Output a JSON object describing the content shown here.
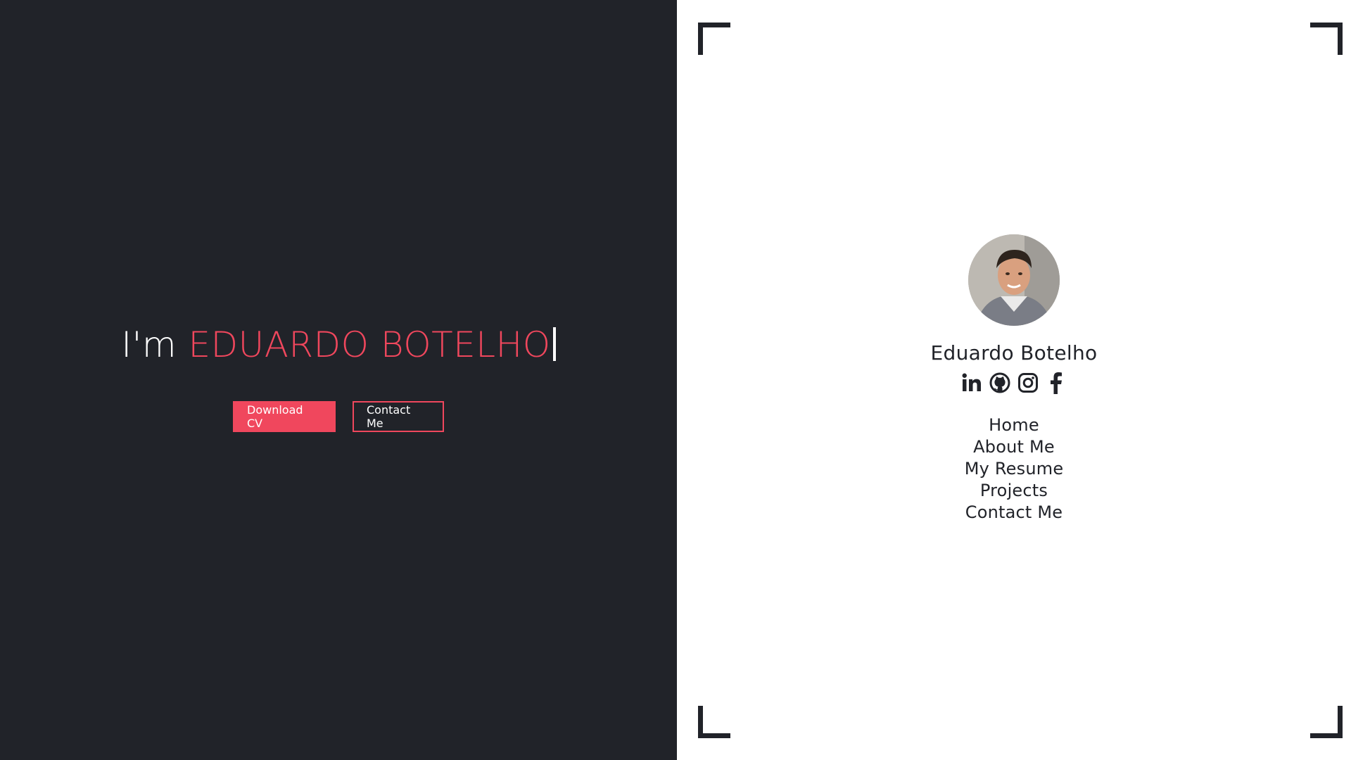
{
  "hero": {
    "prefix": "I'm ",
    "name": "EDUARDO BOTELHO",
    "download_label": "Download CV",
    "contact_label": "Contact Me"
  },
  "profile": {
    "name": "Eduardo Botelho",
    "avatar_alt": "avatar-photo"
  },
  "socials": [
    {
      "icon": "linkedin-icon"
    },
    {
      "icon": "github-icon"
    },
    {
      "icon": "instagram-icon"
    },
    {
      "icon": "facebook-icon"
    }
  ],
  "nav": [
    {
      "label": "Home"
    },
    {
      "label": "About Me"
    },
    {
      "label": "My Resume"
    },
    {
      "label": "Projects"
    },
    {
      "label": "Contact Me"
    }
  ],
  "colors": {
    "accent": "#f0475d",
    "dark": "#212329",
    "light": "#ffffff"
  }
}
